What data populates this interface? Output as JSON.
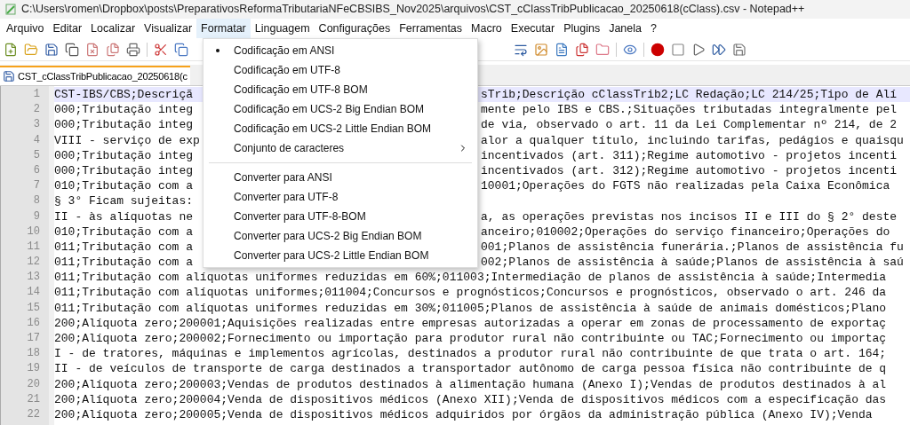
{
  "window": {
    "title": "C:\\Users\\romen\\Dropbox\\posts\\PreparativosReformaTributariaNFeCBSIBS_Nov2025\\arquivos\\CST_cClassTribPublicacao_20250618(cClass).csv - Notepad++"
  },
  "menubar": [
    {
      "label": "Arquivo",
      "selected": false
    },
    {
      "label": "Editar",
      "selected": false
    },
    {
      "label": "Localizar",
      "selected": false
    },
    {
      "label": "Visualizar",
      "selected": false
    },
    {
      "label": "Formatar",
      "selected": true
    },
    {
      "label": "Linguagem",
      "selected": false
    },
    {
      "label": "Configurações",
      "selected": false
    },
    {
      "label": "Ferramentas",
      "selected": false
    },
    {
      "label": "Macro",
      "selected": false
    },
    {
      "label": "Executar",
      "selected": false
    },
    {
      "label": "Plugins",
      "selected": false
    },
    {
      "label": "Janela",
      "selected": false
    },
    {
      "label": "?",
      "selected": false
    }
  ],
  "tabs": [
    {
      "label": "CST_cClassTribPublicacao_20250618(c",
      "selected": true
    }
  ],
  "dropdown": {
    "items": [
      {
        "kind": "item",
        "label": "Codificação em ANSI",
        "checked": true
      },
      {
        "kind": "item",
        "label": "Codificação em UTF-8",
        "checked": false
      },
      {
        "kind": "item",
        "label": "Codificação em UTF-8 BOM",
        "checked": false
      },
      {
        "kind": "item",
        "label": "Codificação em UCS-2 Big Endian BOM",
        "checked": false
      },
      {
        "kind": "item",
        "label": "Codificação em UCS-2 Little Endian BOM",
        "checked": false
      },
      {
        "kind": "submenu",
        "label": "Conjunto de caracteres"
      },
      {
        "kind": "separator"
      },
      {
        "kind": "item",
        "label": "Converter para ANSI",
        "checked": false
      },
      {
        "kind": "item",
        "label": "Converter para UTF-8",
        "checked": false
      },
      {
        "kind": "item",
        "label": "Converter para UTF-8-BOM",
        "checked": false
      },
      {
        "kind": "item",
        "label": "Converter para UCS-2 Big Endian BOM",
        "checked": false
      },
      {
        "kind": "item",
        "label": "Converter para UCS-2 Little Endian BOM",
        "checked": false
      }
    ]
  },
  "editor": {
    "lines": [
      {
        "number": "1",
        "current": true,
        "segments": [
          "CST-IBS/CBS;Descriçã",
          "sTrib;Descrição cClassTrib2;LC Redação;LC 214/25;Tipo de Alí"
        ]
      },
      {
        "number": "2",
        "current": false,
        "segments": [
          "000;Tributação integ",
          "mente pelo IBS e CBS.;Situações tributadas integralmente pel"
        ]
      },
      {
        "number": "3",
        "current": false,
        "segments": [
          "000;Tributação integ",
          "de via, observado o art. 11 da Lei Complementar nº 214, de 2"
        ]
      },
      {
        "number": "4",
        "current": false,
        "segments": [
          "VIII - serviço de exp",
          "alor a qualquer título, incluindo tarifas, pedágios e quaisqu"
        ]
      },
      {
        "number": "5",
        "current": false,
        "segments": [
          "000;Tributação integ",
          "incentivados (art. 311);Regime automotivo - projetos incenti"
        ]
      },
      {
        "number": "6",
        "current": false,
        "segments": [
          "000;Tributação integ",
          "incentivados (art. 312);Regime automotivo - projetos incenti"
        ]
      },
      {
        "number": "7",
        "current": false,
        "segments": [
          "010;Tributação com a",
          "10001;Operações do FGTS não realizadas pela Caixa Econômica"
        ]
      },
      {
        "number": "8",
        "current": false,
        "segments": [
          "§ 3° Ficam sujeitas:"
        ]
      },
      {
        "number": "9",
        "current": false,
        "segments": [
          "II - às alíquotas ne",
          "a, as operações previstas nos incisos II e III do § 2° deste"
        ]
      },
      {
        "number": "10",
        "current": false,
        "segments": [
          "010;Tributação com a",
          "anceiro;010002;Operações do serviço financeiro;Operações do"
        ]
      },
      {
        "number": "11",
        "current": false,
        "segments": [
          "011;Tributação com a",
          "001;Planos de assistência funerária.;Planos de assistência fu"
        ]
      },
      {
        "number": "12",
        "current": false,
        "segments": [
          "011;Tributação com a",
          "002;Planos de assistência à saúde;Planos de assistência à saú"
        ]
      },
      {
        "number": "13",
        "current": false,
        "segments": [
          "011;Tributação com alíquotas uniformes reduzidas em 60%;011003;Intermediação de planos de assistência à saúde;Intermedia"
        ]
      },
      {
        "number": "14",
        "current": false,
        "segments": [
          "011;Tributação com alíquotas uniformes;011004;Concursos e prognósticos;Concursos e prognósticos, observado o art. 246 da"
        ]
      },
      {
        "number": "15",
        "current": false,
        "segments": [
          "011;Tributação com alíquotas uniformes reduzidas em 30%;011005;Planos de assistência à saúde de animais domésticos;Plano"
        ]
      },
      {
        "number": "16",
        "current": false,
        "segments": [
          "200;Alíquota zero;200001;Aquisições realizadas entre empresas autorizadas a operar em zonas de processamento de exportaç"
        ]
      },
      {
        "number": "17",
        "current": false,
        "segments": [
          "200;Alíquota zero;200002;Fornecimento ou importação para produtor rural não contribuinte ou TAC;Fornecimento ou importaç"
        ]
      },
      {
        "number": "18",
        "current": false,
        "segments": [
          "I - de tratores, máquinas e implementos agrícolas, destinados a produtor rural não contribuinte de que trata o art. 164;"
        ]
      },
      {
        "number": "19",
        "current": false,
        "segments": [
          "II - de veículos de transporte de carga destinados a transportador autônomo de carga pessoa física não contribuinte de q"
        ]
      },
      {
        "number": "20",
        "current": false,
        "segments": [
          "200;Alíquota zero;200003;Vendas de produtos destinados à alimentação humana (Anexo I);Vendas de produtos destinados à al"
        ]
      },
      {
        "number": "21",
        "current": false,
        "segments": [
          "200;Alíquota zero;200004;Venda de dispositivos médicos (Anexo XII);Venda de dispositivos médicos com a especificação das"
        ]
      },
      {
        "number": "22",
        "current": false,
        "segments": [
          "200;Alíquota zero;200005;Venda de dispositivos médicos adquiridos por órgãos da administração pública (Anexo IV);Venda"
        ]
      }
    ]
  }
}
